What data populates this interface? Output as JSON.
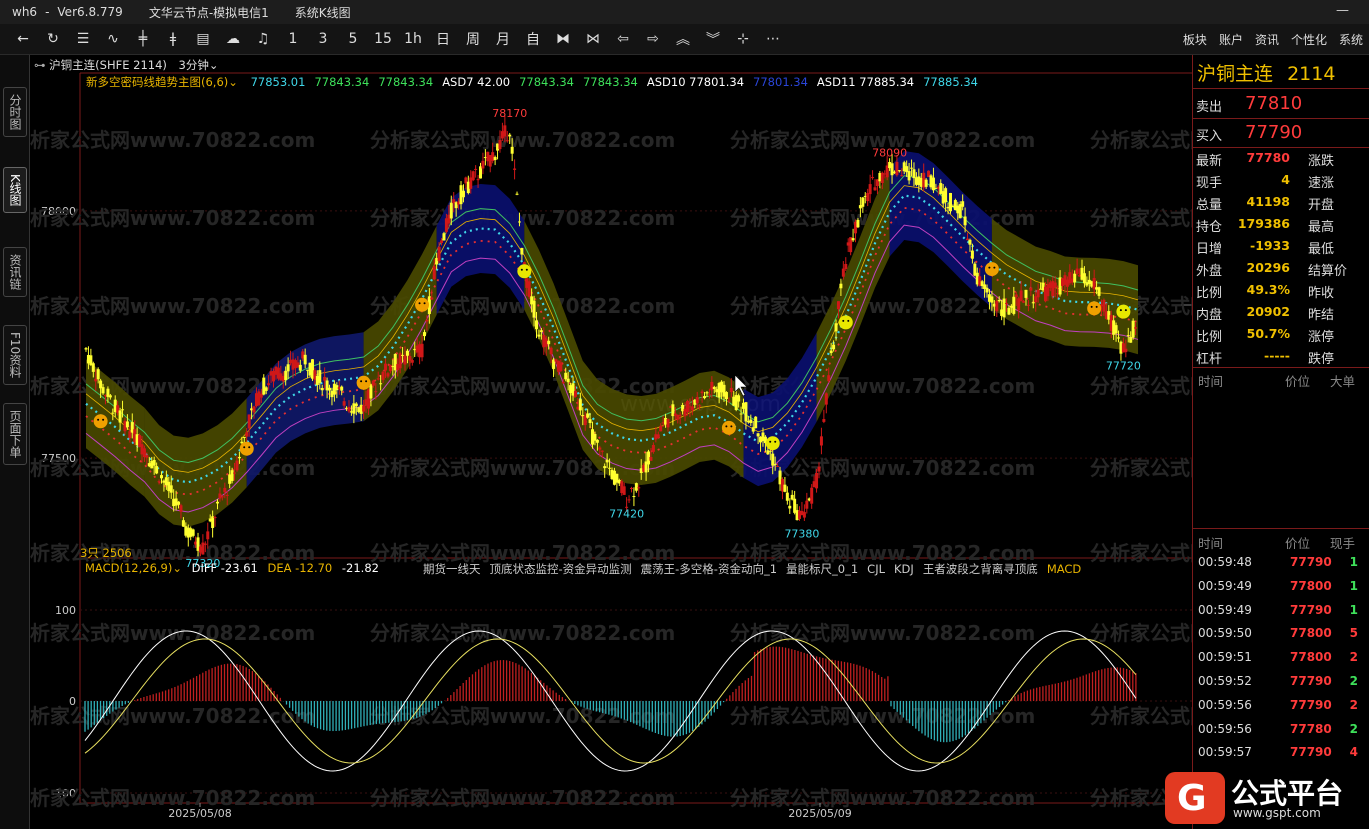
{
  "titlebar": {
    "app": "wh6",
    "sep": "-",
    "version": "Ver6.8.779",
    "server": "文华云节点-模拟电信1",
    "view": "系统K线图",
    "winctl": "—"
  },
  "toolbar": {
    "periods": [
      "1",
      "3",
      "5",
      "15",
      "1h",
      "日",
      "周",
      "月",
      "自"
    ],
    "right_menu": [
      "板块",
      "账户",
      "资讯",
      "个性化",
      "系统"
    ]
  },
  "left_tabs": [
    "分时图",
    "K线图",
    "资讯链",
    "F10资料",
    "页面下单"
  ],
  "header": {
    "contract": "沪铜主连(SHFE 2114)",
    "period": "3分钟"
  },
  "main_indicator": {
    "name": "新多空密码线趋势主图(6,6)",
    "values": [
      {
        "text": "77853.01",
        "color": "#3fd6e8"
      },
      {
        "text": "77843.34",
        "color": "#3ee05a"
      },
      {
        "text": "77843.34",
        "color": "#3ee05a"
      },
      {
        "text": "ASD7 42.00",
        "color": "#ffffff"
      },
      {
        "text": "77843.34",
        "color": "#3ee05a"
      },
      {
        "text": "77843.34",
        "color": "#3ee05a"
      },
      {
        "text": "ASD10 77801.34",
        "color": "#ffffff"
      },
      {
        "text": "77801.34",
        "color": "#2a45d8"
      },
      {
        "text": "ASD11 77885.34",
        "color": "#ffffff"
      },
      {
        "text": "77885.34",
        "color": "#3fd6e8"
      }
    ]
  },
  "price_axis": [
    "78000",
    "77500"
  ],
  "annotations": [
    {
      "text": "78170",
      "color": "#ff3b3b"
    },
    {
      "text": "78090",
      "color": "#ff3b3b"
    },
    {
      "text": "77320",
      "color": "#3fd6e8"
    },
    {
      "text": "77420",
      "color": "#3fd6e8"
    },
    {
      "text": "77380",
      "color": "#3fd6e8"
    },
    {
      "text": "77720",
      "color": "#3fd6e8"
    }
  ],
  "volume_label": "3只 2506",
  "macd": {
    "name": "MACD(12,26,9)",
    "diff": "DIFF -23.61",
    "dea": "DEA -12.70",
    "macd": "-21.82",
    "tabs": [
      "期货一线天",
      "顶底状态监控-资金异动监测",
      "震荡王-多空格-资金动向_1",
      "量能标尺_0_1",
      "CJL",
      "KDJ",
      "王者波段之背离寻顶底",
      "MACD"
    ],
    "axis": [
      "100",
      "0",
      "-100"
    ]
  },
  "dates": [
    "2025/05/08",
    "2025/05/09"
  ],
  "watermark": "分析家公式网www.70822.com",
  "center_watermark": "www.gspt.com",
  "quote": {
    "name": "沪铜主连",
    "code": "2114",
    "sell_label": "卖出",
    "sell": "77810",
    "buy_label": "买入",
    "buy": "77790",
    "rows": [
      {
        "label": "最新",
        "value": "77780",
        "color": "#ff3b3b",
        "label2": "涨跌"
      },
      {
        "label": "现手",
        "value": "4",
        "color": "#f0c000",
        "label2": "速涨"
      },
      {
        "label": "总量",
        "value": "41198",
        "color": "#f0c000",
        "label2": "开盘"
      },
      {
        "label": "持仓",
        "value": "179386",
        "color": "#f0c000",
        "label2": "最高"
      },
      {
        "label": "日增",
        "value": "-1933",
        "color": "#f0c000",
        "label2": "最低"
      },
      {
        "label": "外盘",
        "value": "20296",
        "color": "#f0c000",
        "label2": "结算价"
      },
      {
        "label": "比例",
        "value": "49.3%",
        "color": "#f0c000",
        "label2": "昨收"
      },
      {
        "label": "内盘",
        "value": "20902",
        "color": "#f0c000",
        "label2": "昨结"
      },
      {
        "label": "比例",
        "value": "50.7%",
        "color": "#f0c000",
        "label2": "涨停"
      },
      {
        "label": "杠杆",
        "value": "-----",
        "color": "#f0c000",
        "label2": "跌停"
      }
    ],
    "bigorder_headers": [
      "时间",
      "价位",
      "大单"
    ]
  },
  "ticks": {
    "headers": [
      "时间",
      "价位",
      "现手"
    ],
    "rows": [
      {
        "time": "00:59:48",
        "price": "77790",
        "price_color": "#ff3b3b",
        "vol": "1",
        "vol_color": "#3ee05a"
      },
      {
        "time": "00:59:49",
        "price": "77800",
        "price_color": "#ff3b3b",
        "vol": "1",
        "vol_color": "#3ee05a"
      },
      {
        "time": "00:59:49",
        "price": "77790",
        "price_color": "#ff3b3b",
        "vol": "1",
        "vol_color": "#3ee05a"
      },
      {
        "time": "00:59:50",
        "price": "77800",
        "price_color": "#ff3b3b",
        "vol": "5",
        "vol_color": "#ff3b3b"
      },
      {
        "time": "00:59:51",
        "price": "77800",
        "price_color": "#ff3b3b",
        "vol": "2",
        "vol_color": "#ff3b3b"
      },
      {
        "time": "00:59:52",
        "price": "77790",
        "price_color": "#ff3b3b",
        "vol": "2",
        "vol_color": "#3ee05a"
      },
      {
        "time": "00:59:56",
        "price": "77790",
        "price_color": "#ff3b3b",
        "vol": "2",
        "vol_color": "#ff3b3b"
      },
      {
        "time": "00:59:56",
        "price": "77780",
        "price_color": "#ff3b3b",
        "vol": "2",
        "vol_color": "#3ee05a"
      },
      {
        "time": "00:59:57",
        "price": "77790",
        "price_color": "#ff3b3b",
        "vol": "4",
        "vol_color": "#ff3b3b"
      }
    ]
  },
  "logo": {
    "name": "公式平台",
    "url": "www.gspt.com"
  },
  "chart_data": {
    "type": "line",
    "title": "",
    "series": [
      {
        "values": [
          77720,
          77650,
          77600,
          77560,
          77520,
          77470,
          77420,
          77350,
          77320,
          77400,
          77460,
          77560,
          77640,
          77670,
          77680,
          77700,
          77660,
          77640,
          77610,
          77600,
          77660,
          77690,
          77700,
          77720,
          77900,
          78000,
          78050,
          78080,
          78120,
          78170,
          77880,
          77760,
          77700,
          77650,
          77600,
          77520,
          77470,
          77420,
          77460,
          77540,
          77590,
          77600,
          77620,
          77640,
          77630,
          77600,
          77560,
          77500,
          77420,
          77380,
          77450,
          77700,
          77900,
          78000,
          78060,
          78090,
          78080,
          78070,
          78060,
          78020,
          78000,
          77860,
          77820,
          77800,
          77820,
          77830,
          77840,
          77850,
          77870,
          77850,
          77780,
          77720,
          77780
        ]
      }
    ],
    "ylim": [
      77300,
      78200
    ]
  }
}
